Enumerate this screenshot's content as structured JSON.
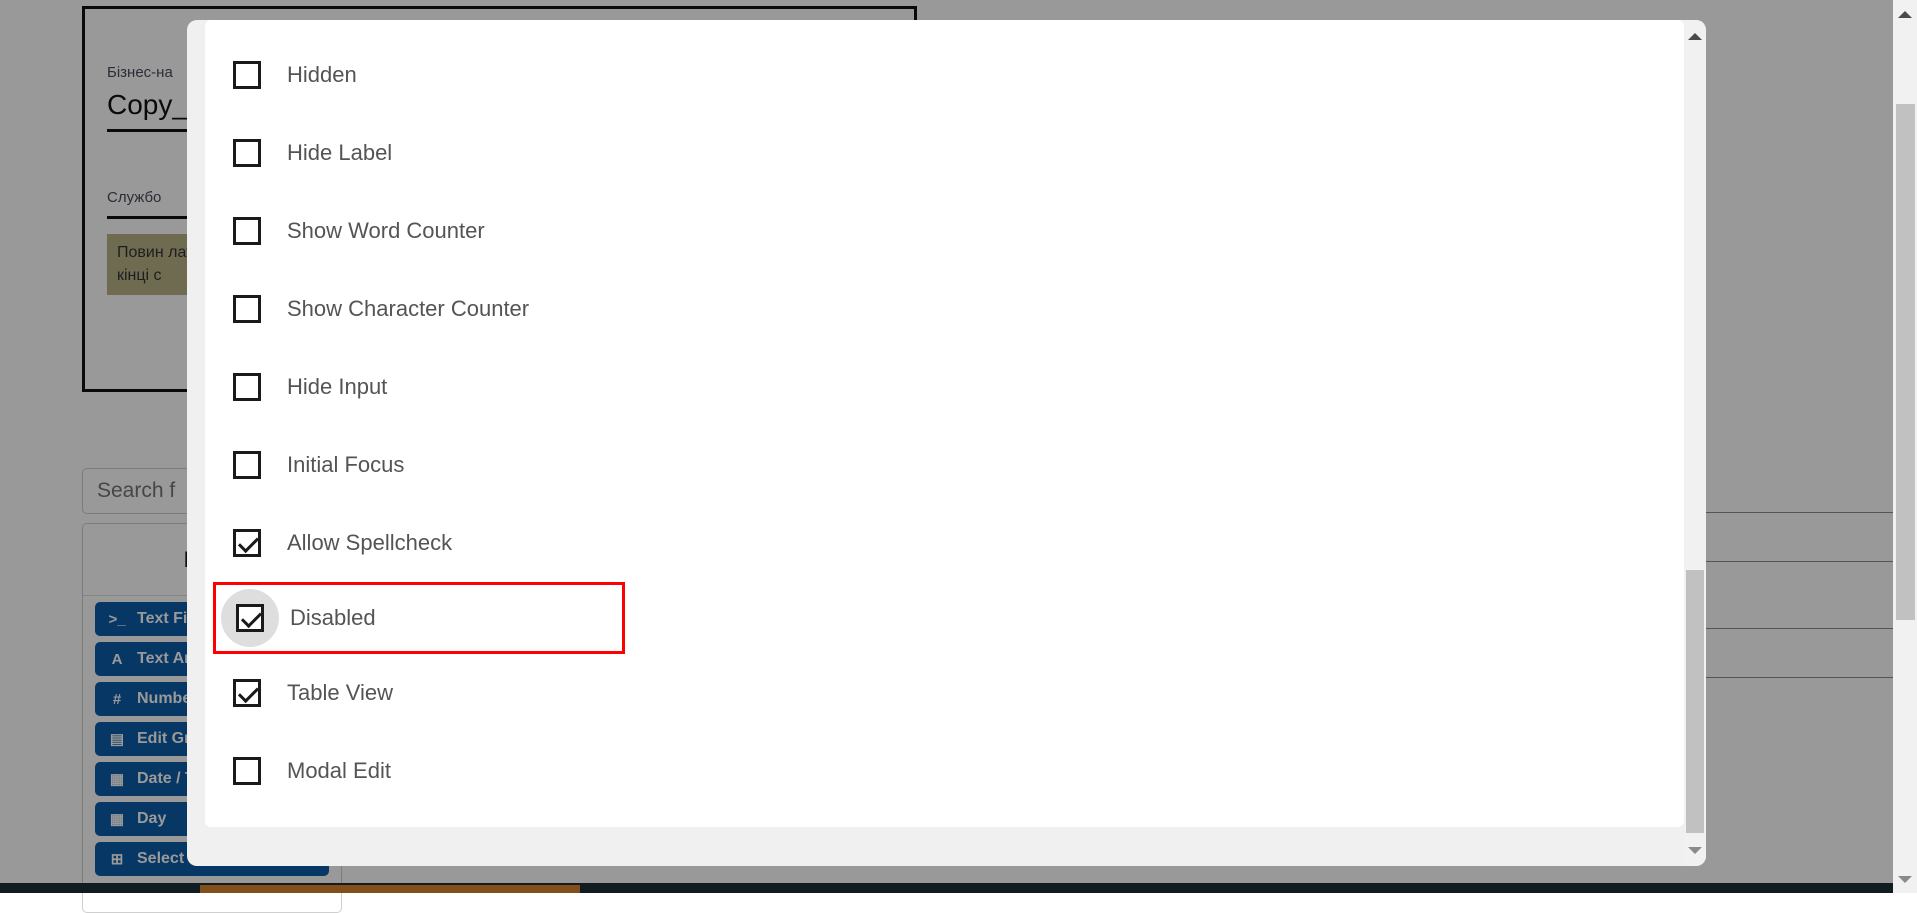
{
  "overlay": {
    "color": "#999999",
    "note": "dimmed-backdrop"
  },
  "modal": {
    "accent_highlight_color": "#ff0000",
    "focus_ring_color": "#dedede",
    "checkboxes": [
      {
        "label": "Hidden",
        "checked": false,
        "highlighted": false,
        "focused": false
      },
      {
        "label": "Hide Label",
        "checked": false,
        "highlighted": false,
        "focused": false
      },
      {
        "label": "Show Word Counter",
        "checked": false,
        "highlighted": false,
        "focused": false
      },
      {
        "label": "Show Character Counter",
        "checked": false,
        "highlighted": false,
        "focused": false
      },
      {
        "label": "Hide Input",
        "checked": false,
        "highlighted": false,
        "focused": false
      },
      {
        "label": "Initial Focus",
        "checked": false,
        "highlighted": false,
        "focused": false
      },
      {
        "label": "Allow Spellcheck",
        "checked": true,
        "highlighted": false,
        "focused": false
      },
      {
        "label": "Disabled",
        "checked": true,
        "highlighted": true,
        "focused": true
      },
      {
        "label": "Table View",
        "checked": true,
        "highlighted": false,
        "focused": false
      },
      {
        "label": "Modal Edit",
        "checked": false,
        "highlighted": false,
        "focused": false
      }
    ],
    "scrollbar": {
      "up_arrow": "▲",
      "down_arrow": "▼"
    }
  },
  "background": {
    "form": {
      "field1_label": "Бізнес-на",
      "field1_value": "Copy_",
      "field2_label": "Службо",
      "warning_text": "Повин латини кінці с"
    },
    "search_placeholder": "Search f",
    "panel_title": "Комп",
    "components": [
      {
        "icon": ">_",
        "icon_name": "terminal-icon",
        "label": "Text Fie"
      },
      {
        "icon": "A",
        "icon_name": "letter-a-icon",
        "label": "Text Ar"
      },
      {
        "icon": "#",
        "icon_name": "hash-icon",
        "label": "Numbe"
      },
      {
        "icon": "▤",
        "icon_name": "grid-icon",
        "label": "Edit Gri"
      },
      {
        "icon": "▦",
        "icon_name": "calendar-icon",
        "label": "Date / T"
      },
      {
        "icon": "▦",
        "icon_name": "calendar-icon",
        "label": "Day"
      },
      {
        "icon": "⊞",
        "icon_name": "select-boxes-icon",
        "label": "Select Boxes"
      }
    ],
    "colors": {
      "button_blue": "#0b5ca8",
      "warning_olive": "#b9b288",
      "bottom_bar": "#1d3037",
      "bottom_accent": "#d9822b"
    }
  },
  "page_scrollbar": {
    "up_arrow": "▲",
    "down_arrow": "▼"
  }
}
